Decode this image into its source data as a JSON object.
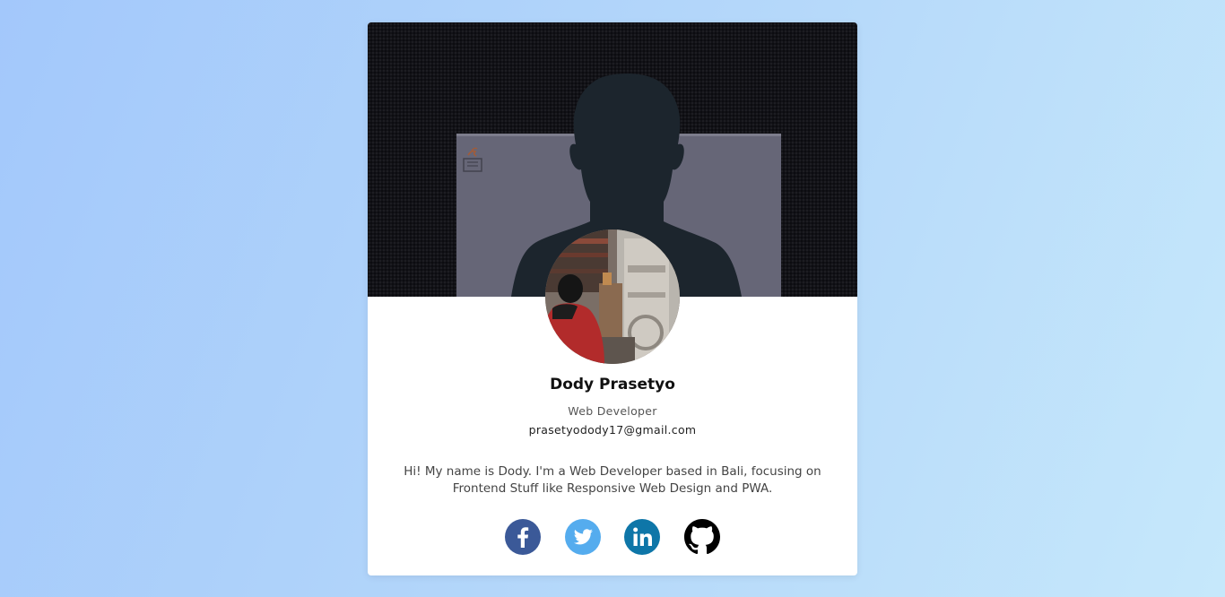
{
  "profile": {
    "name": "Dody Prasetyo",
    "role": "Web Developer",
    "email": "prasetyodody17@gmail.com",
    "bio": "Hi! My name is Dody. I'm a Web Developer based in Bali, focusing on Frontend Stuff like Responsive Web Design and PWA."
  },
  "social": [
    {
      "name": "facebook",
      "icon": "facebook-icon",
      "color": "#3b5998"
    },
    {
      "name": "twitter",
      "icon": "twitter-icon",
      "color": "#55acee"
    },
    {
      "name": "linkedin",
      "icon": "linkedin-icon",
      "color": "#0e76a8"
    },
    {
      "name": "github",
      "icon": "github-icon",
      "color": "#000000"
    }
  ],
  "colors": {
    "background_start": "#a3c8fb",
    "background_end": "#c6e8fb",
    "card": "#ffffff",
    "cover": "#121217"
  }
}
